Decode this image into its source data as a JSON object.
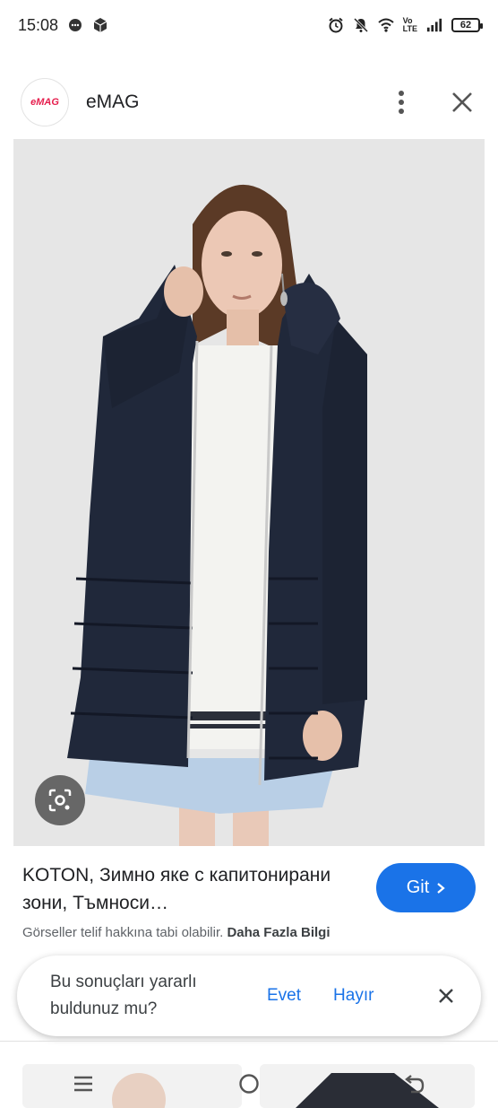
{
  "status_bar": {
    "time": "15:08",
    "lte_top": "Vo",
    "lte_bottom": "LTE",
    "battery": "62"
  },
  "header": {
    "logo_text": "eMAG",
    "site_name": "eMAG",
    "more_icon": "more-vert-icon",
    "close_icon": "close-icon"
  },
  "image": {
    "lens_icon": "lens-icon"
  },
  "caption": {
    "title": "KOTON, Зимно яке с капитонирани зони, Тъмноси…",
    "visit_label": "Git",
    "copyright_text": "Görseller telif hakkına tabi olabilir.",
    "learn_more": "Daha Fazla Bilgi"
  },
  "feedback": {
    "question": "Bu sonuçları yararlı buldunuz mu?",
    "yes": "Evet",
    "no": "Hayır"
  },
  "colors": {
    "accent": "#1a73e8",
    "coat": "#1f2535",
    "background": "#e7e7e7"
  }
}
